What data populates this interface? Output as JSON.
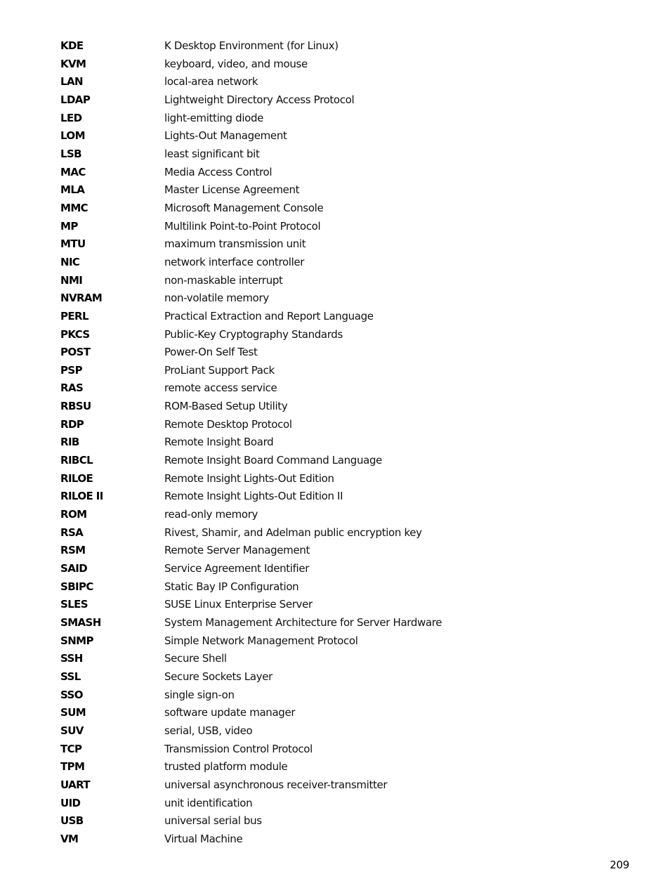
{
  "glossary": {
    "entries": [
      {
        "term": "KDE",
        "definition": "K Desktop Environment (for Linux)"
      },
      {
        "term": "KVM",
        "definition": "keyboard, video, and mouse"
      },
      {
        "term": "LAN",
        "definition": "local-area network"
      },
      {
        "term": "LDAP",
        "definition": "Lightweight Directory Access Protocol"
      },
      {
        "term": "LED",
        "definition": "light-emitting diode"
      },
      {
        "term": "LOM",
        "definition": "Lights-Out Management"
      },
      {
        "term": "LSB",
        "definition": "least significant bit"
      },
      {
        "term": "MAC",
        "definition": "Media Access Control"
      },
      {
        "term": "MLA",
        "definition": "Master License Agreement"
      },
      {
        "term": "MMC",
        "definition": "Microsoft Management Console"
      },
      {
        "term": "MP",
        "definition": "Multilink Point-to-Point Protocol"
      },
      {
        "term": "MTU",
        "definition": "maximum transmission unit"
      },
      {
        "term": "NIC",
        "definition": "network interface controller"
      },
      {
        "term": "NMI",
        "definition": "non-maskable interrupt"
      },
      {
        "term": "NVRAM",
        "definition": "non-volatile memory"
      },
      {
        "term": "PERL",
        "definition": "Practical Extraction and Report Language"
      },
      {
        "term": "PKCS",
        "definition": "Public-Key Cryptography Standards"
      },
      {
        "term": "POST",
        "definition": "Power-On Self Test"
      },
      {
        "term": "PSP",
        "definition": "ProLiant Support Pack"
      },
      {
        "term": "RAS",
        "definition": "remote access service"
      },
      {
        "term": "RBSU",
        "definition": "ROM-Based Setup Utility"
      },
      {
        "term": "RDP",
        "definition": "Remote Desktop Protocol"
      },
      {
        "term": "RIB",
        "definition": "Remote Insight Board"
      },
      {
        "term": "RIBCL",
        "definition": "Remote Insight Board Command Language"
      },
      {
        "term": "RILOE",
        "definition": "Remote Insight Lights-Out Edition"
      },
      {
        "term": "RILOE II",
        "definition": "Remote Insight Lights-Out Edition II"
      },
      {
        "term": "ROM",
        "definition": "read-only memory"
      },
      {
        "term": "RSA",
        "definition": "Rivest, Shamir, and Adelman public encryption key"
      },
      {
        "term": "RSM",
        "definition": "Remote Server Management"
      },
      {
        "term": "SAID",
        "definition": "Service Agreement Identifier"
      },
      {
        "term": "SBIPC",
        "definition": "Static Bay IP Configuration"
      },
      {
        "term": "SLES",
        "definition": "SUSE Linux Enterprise Server"
      },
      {
        "term": "SMASH",
        "definition": "System Management Architecture for Server Hardware"
      },
      {
        "term": "SNMP",
        "definition": "Simple Network Management Protocol"
      },
      {
        "term": "SSH",
        "definition": "Secure Shell"
      },
      {
        "term": "SSL",
        "definition": "Secure Sockets Layer"
      },
      {
        "term": "SSO",
        "definition": "single sign-on"
      },
      {
        "term": "SUM",
        "definition": "software update manager"
      },
      {
        "term": "SUV",
        "definition": "serial, USB, video"
      },
      {
        "term": "TCP",
        "definition": "Transmission Control Protocol"
      },
      {
        "term": "TPM",
        "definition": "trusted platform module"
      },
      {
        "term": "UART",
        "definition": "universal asynchronous receiver-transmitter"
      },
      {
        "term": "UID",
        "definition": "unit identification"
      },
      {
        "term": "USB",
        "definition": "universal serial bus"
      },
      {
        "term": "VM",
        "definition": "Virtual Machine"
      }
    ]
  },
  "footer": {
    "page_number": "209"
  }
}
